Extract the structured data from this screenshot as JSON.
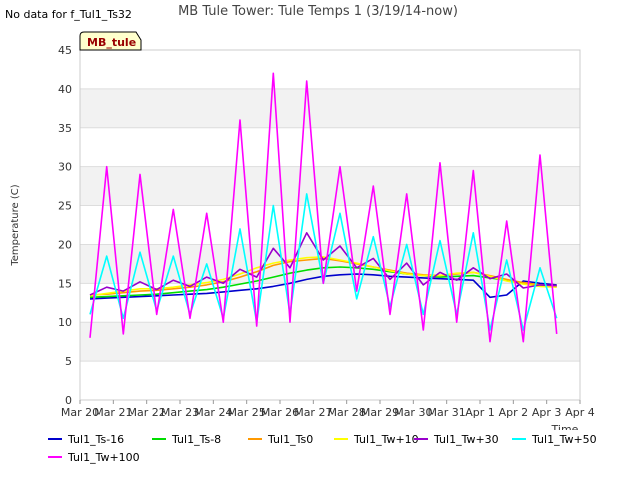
{
  "header": {
    "nodata_note": "No data for f_Tul1_Ts32"
  },
  "chart_data": {
    "type": "line",
    "title": "MB Tule Tower: Tule Temps 1 (3/19/14-now)",
    "xlabel": "Time",
    "ylabel": "Temperature (C)",
    "station_tag": "MB_tule",
    "ylim": [
      0,
      45
    ],
    "yticks": [
      0,
      5,
      10,
      15,
      20,
      25,
      30,
      35,
      40,
      45
    ],
    "xlim": [
      0,
      15
    ],
    "xtick_labels": [
      "Mar 20",
      "Mar 21",
      "Mar 22",
      "Mar 23",
      "Mar 24",
      "Mar 25",
      "Mar 26",
      "Mar 27",
      "Mar 28",
      "Mar 29",
      "Mar 30",
      "Mar 31",
      "Apr 1",
      "Apr 2",
      "Apr 3",
      "Apr 4"
    ],
    "grid": true,
    "legend_position": "bottom",
    "colors": {
      "Tul1_Ts-16": "#0000cc",
      "Tul1_Ts-8": "#00dd00",
      "Tul1_Ts0": "#ff9900",
      "Tul1_Tw+10": "#ffff00",
      "Tul1_Tw+30": "#9900cc",
      "Tul1_Tw+50": "#00ffff",
      "Tul1_Tw+100": "#ff00ff"
    },
    "x": [
      0.3,
      0.8,
      1.3,
      1.8,
      2.3,
      2.8,
      3.3,
      3.8,
      4.3,
      4.8,
      5.3,
      5.8,
      6.3,
      6.8,
      7.3,
      7.8,
      8.3,
      8.8,
      9.3,
      9.8,
      10.3,
      10.8,
      11.3,
      11.8,
      12.3,
      12.8,
      13.3,
      13.8,
      14.3
    ],
    "series": [
      {
        "name": "Tul1_Ts-16",
        "values": [
          13,
          13.1,
          13.2,
          13.3,
          13.4,
          13.5,
          13.6,
          13.7,
          13.9,
          14.1,
          14.3,
          14.6,
          15,
          15.5,
          15.9,
          16.1,
          16.2,
          16.1,
          15.9,
          15.8,
          15.7,
          15.6,
          15.5,
          15.4,
          13.2,
          13.5,
          15.3,
          15,
          14.8
        ]
      },
      {
        "name": "Tul1_Ts-8",
        "values": [
          13.2,
          13.3,
          13.4,
          13.5,
          13.6,
          13.8,
          14,
          14.2,
          14.5,
          14.9,
          15.3,
          15.8,
          16.3,
          16.7,
          17,
          17.1,
          17,
          16.8,
          16.5,
          16.2,
          16,
          15.8,
          15.9,
          16,
          15.7,
          15.4,
          15,
          14.7,
          14.6
        ]
      },
      {
        "name": "Tul1_Ts0",
        "values": [
          13.5,
          13.6,
          13.8,
          14,
          14.1,
          14.3,
          14.5,
          14.8,
          15.2,
          15.8,
          16.5,
          17.3,
          17.8,
          18,
          18.2,
          17.9,
          17.5,
          17.1,
          16.7,
          16.3,
          16.1,
          16,
          16.2,
          16.4,
          16,
          15.5,
          15.1,
          14.8,
          14.7
        ]
      },
      {
        "name": "Tul1_Tw+10",
        "values": [
          13.4,
          13.7,
          14,
          14.3,
          14.3,
          14.5,
          14.8,
          15.1,
          15.5,
          16.2,
          17,
          17.6,
          18,
          18.3,
          18.4,
          18,
          17.6,
          17.1,
          16.6,
          16.2,
          16,
          16,
          16.3,
          16.4,
          15.9,
          15.3,
          14.9,
          14.6,
          14.5
        ]
      },
      {
        "name": "Tul1_Tw+30",
        "values": [
          13.5,
          14.5,
          14,
          15.2,
          14.2,
          15.4,
          14.6,
          15.8,
          15,
          16.8,
          15.8,
          19.5,
          17,
          21.5,
          18,
          19.8,
          17,
          18.2,
          15.5,
          17.6,
          14.8,
          16.4,
          15.4,
          17,
          15.6,
          16.2,
          14.4,
          14.8,
          14.7
        ]
      },
      {
        "name": "Tul1_Tw+50",
        "values": [
          11,
          18.5,
          10.5,
          19,
          11.5,
          18.5,
          11,
          17.5,
          10.5,
          22,
          10,
          25,
          11,
          26.5,
          15,
          24,
          13,
          21,
          12,
          20,
          11,
          20.5,
          11,
          21.5,
          9,
          18,
          9,
          17,
          10.5
        ]
      },
      {
        "name": "Tul1_Tw+100",
        "values": [
          8,
          30,
          8.5,
          29,
          11,
          24.5,
          10.5,
          24,
          10,
          36,
          9.5,
          42,
          10,
          41,
          15,
          30,
          14,
          27.5,
          11,
          26.5,
          9,
          30.5,
          10,
          29.5,
          7.5,
          23,
          7.5,
          31.5,
          8.5
        ]
      }
    ]
  }
}
